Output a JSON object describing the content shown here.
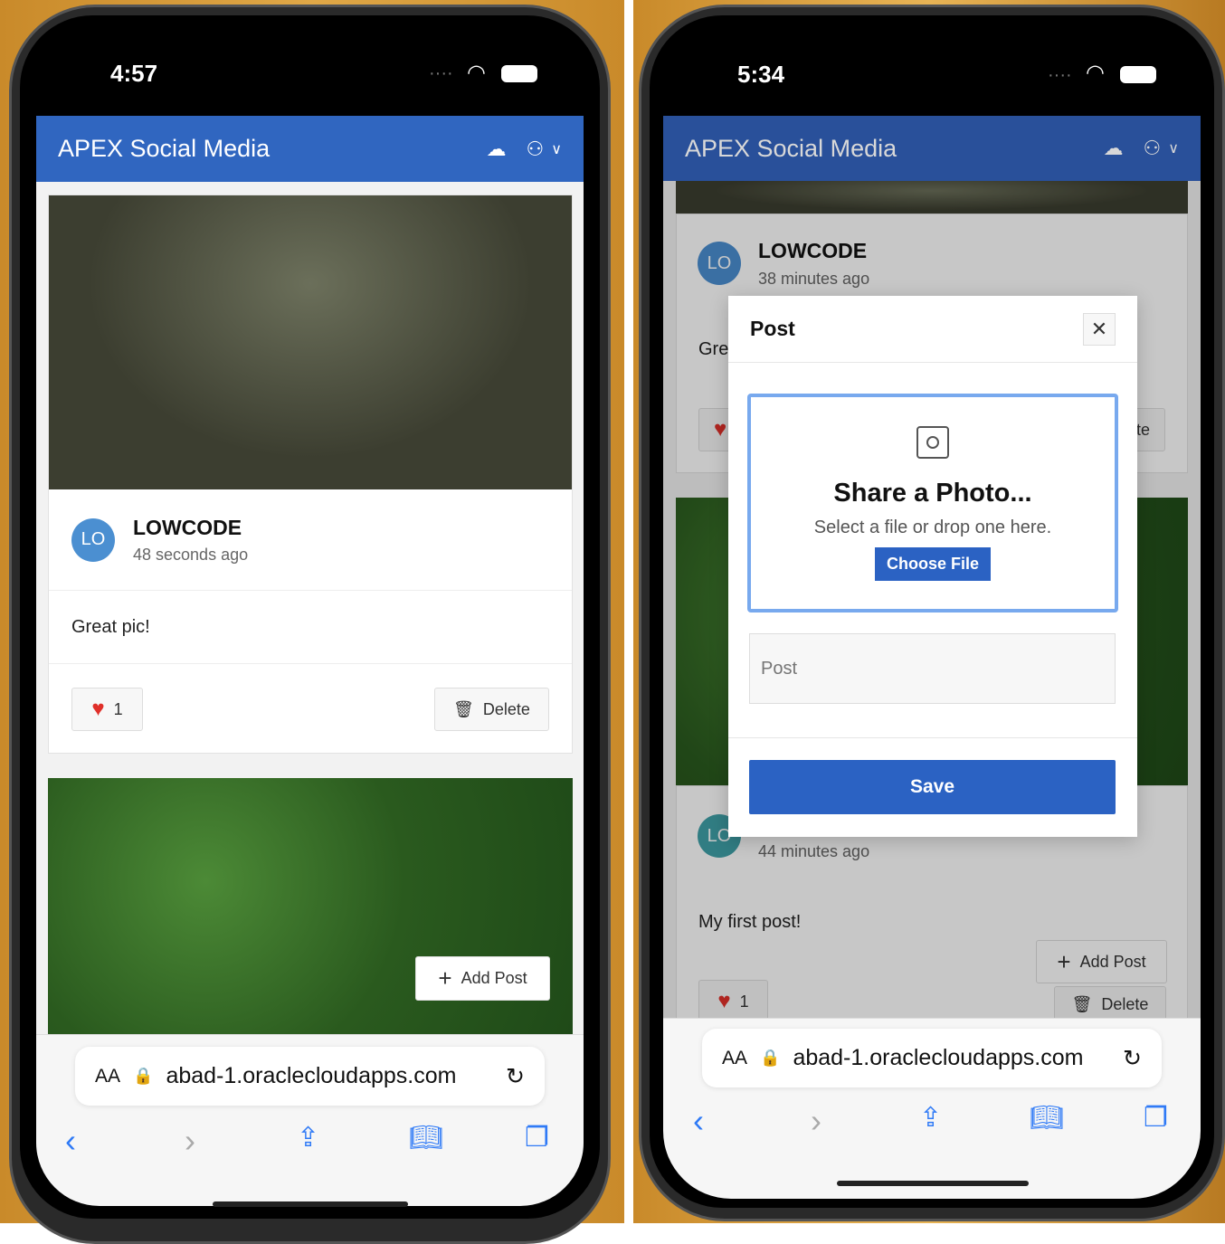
{
  "left": {
    "status": {
      "time": "4:57"
    },
    "header": {
      "title": "APEX Social Media",
      "icons": [
        "cloud-download-icon",
        "user-icon",
        "chevron-down-icon"
      ]
    },
    "post": {
      "avatar": "LO",
      "user": "LOWCODE",
      "time_ago": "48 seconds ago",
      "text": "Great pic!",
      "likes": "1",
      "delete_label": "Delete"
    },
    "add_post_label": "Add Post",
    "url": "abad-1.oraclecloudapps.com",
    "text_size": "AA"
  },
  "right": {
    "status": {
      "time": "5:34"
    },
    "header": {
      "title": "APEX Social Media"
    },
    "post1": {
      "avatar": "LO",
      "user": "LOWCODE",
      "time_ago": "38 minutes ago",
      "text": "Gre",
      "delete_partial": "te"
    },
    "post2": {
      "avatar": "LO",
      "time_ago": "44 minutes ago",
      "text": "My first post!",
      "likes": "1",
      "delete_label": "Delete"
    },
    "add_post_label": "Add Post",
    "dialog": {
      "title": "Post",
      "drop_title": "Share a Photo...",
      "drop_hint": "Select a file or drop one here.",
      "choose_file": "Choose File",
      "post_placeholder": "Post",
      "save_label": "Save"
    },
    "url": "abad-1.oraclecloudapps.com",
    "text_size": "AA"
  },
  "colors": {
    "header": "#3066c0",
    "like": "#e0302a",
    "accent": "#2f7af6"
  }
}
